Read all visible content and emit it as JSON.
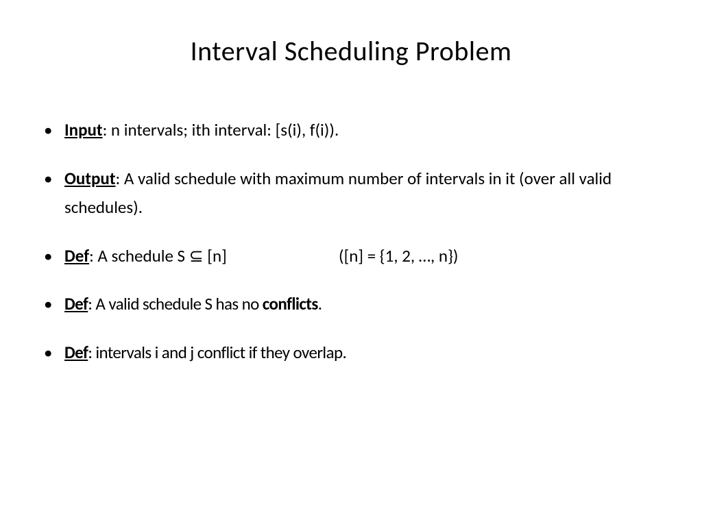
{
  "title": "Interval Scheduling Problem",
  "bullets": {
    "b1": {
      "term": "Input",
      "text": ": n intervals; ith interval: [s(i), f(i))."
    },
    "b2": {
      "term": "Output",
      "text": ": A valid schedule with maximum number of intervals in it (over all valid schedules)."
    },
    "b3": {
      "term": "Def",
      "left": ": A schedule S ⊆ [n]",
      "right": "([n] = {1, 2, …, n})"
    },
    "b4": {
      "term": "Def",
      "text_before": ": A valid schedule S has no ",
      "bold": "conflicts",
      "text_after": "."
    },
    "b5": {
      "term": "Def",
      "text": ": intervals i and j conflict if they overlap."
    }
  }
}
